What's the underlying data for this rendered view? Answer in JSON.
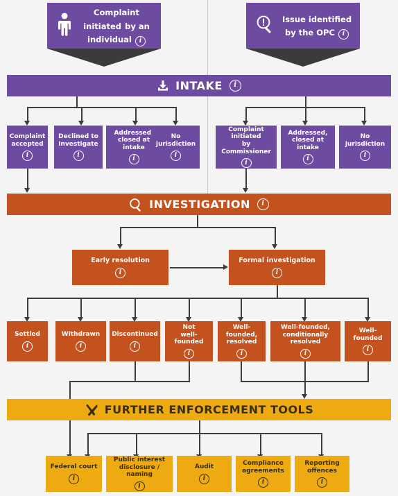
{
  "diagram": {
    "title": "Complaint and investigation process flow",
    "colors": {
      "purple": "#6c4ba0",
      "orange": "#c4521f",
      "yellow": "#eeaa11",
      "ribbon": "#3b3b3b",
      "connector": "#3d3d3d",
      "background": "#f4f4f4"
    },
    "info_glyph": "i"
  },
  "entry_points": [
    {
      "icon": "person-icon",
      "line1": "Complaint initiated",
      "line2": "by an individual",
      "info": "i"
    },
    {
      "icon": "magnifier-alert-icon",
      "line1": "Issue identified",
      "line2": "by the OPC",
      "info": "i"
    }
  ],
  "stage_bars": {
    "intake": {
      "label": "INTAKE",
      "icon": "inbox-download-icon",
      "info": "i",
      "has_info": true
    },
    "investigation": {
      "label": "INVESTIGATION",
      "icon": "magnifier-icon",
      "info": "i",
      "has_info": true
    },
    "enforcement": {
      "label": "FURTHER ENFORCEMENT TOOLS",
      "icon": "tools-icon",
      "info": "",
      "has_info": false
    }
  },
  "intake_outcomes_left": [
    {
      "line1": "Complaint",
      "line2": "accepted",
      "info": "i"
    },
    {
      "line1": "Declined to",
      "line2": "investigate",
      "info": "i"
    },
    {
      "line1": "Addressed,",
      "line2": "closed at intake",
      "info": "i"
    },
    {
      "line1": "No jurisdiction",
      "line2": "",
      "info": "i"
    }
  ],
  "intake_outcomes_right": [
    {
      "line1": "Complaint initiated",
      "line2": "by Commissioner",
      "info": "i"
    },
    {
      "line1": "Addressed,",
      "line2": "closed at intake",
      "info": "i"
    },
    {
      "line1": "No jurisdiction",
      "line2": "",
      "info": "i"
    }
  ],
  "investigation_paths": [
    {
      "line1": "Early resolution",
      "line2": "",
      "info": "i"
    },
    {
      "line1": "Formal investigation",
      "line2": "",
      "info": "i"
    }
  ],
  "investigation_outcomes": [
    {
      "line1": "Settled",
      "line2": "",
      "info": "i"
    },
    {
      "line1": "Withdrawn",
      "line2": "",
      "info": "i"
    },
    {
      "line1": "Discontinued",
      "line2": "",
      "info": "i"
    },
    {
      "line1": "Not",
      "line2": "well-founded",
      "info": "i"
    },
    {
      "line1": "Well-founded,",
      "line2": "resolved",
      "info": "i"
    },
    {
      "line1": "Well-founded,",
      "line2": "conditionally resolved",
      "info": "i"
    },
    {
      "line1": "Well-founded",
      "line2": "",
      "info": "i"
    }
  ],
  "enforcement_tools": [
    {
      "line1": "Federal court",
      "line2": "",
      "info": "i"
    },
    {
      "line1": "Public interest",
      "line2": "disclosure / naming",
      "info": "i"
    },
    {
      "line1": "Audit",
      "line2": "",
      "info": "i"
    },
    {
      "line1": "Compliance",
      "line2": "agreements",
      "info": "i"
    },
    {
      "line1": "Reporting",
      "line2": "offences",
      "info": "i"
    }
  ]
}
